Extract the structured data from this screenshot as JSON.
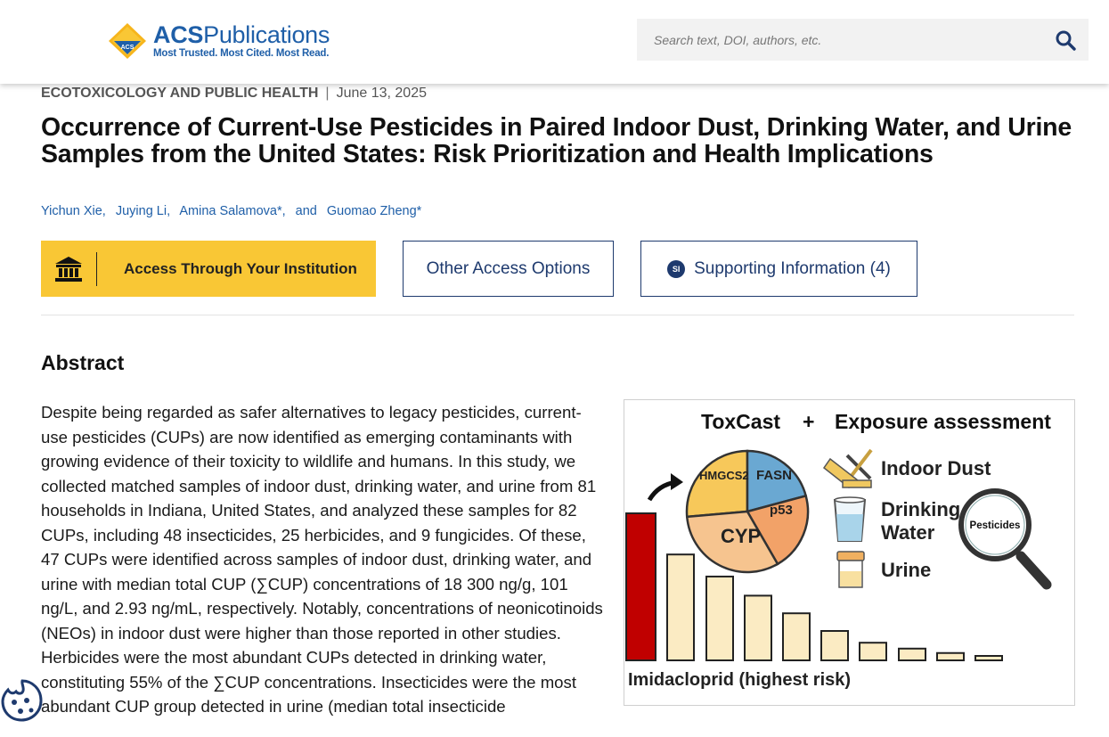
{
  "header": {
    "logo_main": "ACS",
    "logo_sub": "Publications",
    "logo_tagline": "Most Trusted. Most Cited. Most Read.",
    "logo_diamond": "ACS",
    "search_placeholder": "Search text, DOI, authors, etc."
  },
  "article": {
    "category": "ECOTOXICOLOGY AND PUBLIC HEALTH",
    "separator": "|",
    "date": "June 13, 2025",
    "title": "Occurrence of Current-Use Pesticides in Paired Indoor Dust, Drinking Water, and Urine Samples from the United States: Risk Prioritization and Health Implications",
    "authors": [
      "Yichun Xie,",
      "Juying Li,",
      "Amina Salamova*,"
    ],
    "authors_and": "and",
    "last_author": "Guomao Zheng*"
  },
  "access": {
    "institution_label": "Access Through Your Institution",
    "other_label": "Other Access Options",
    "si_badge": "SI",
    "si_label": "Supporting Information (4)"
  },
  "abstract": {
    "heading": "Abstract",
    "text": "Despite being regarded as safer alternatives to legacy pesticides, current-use pesticides (CUPs) are now identified as emerging contaminants with growing evidence of their toxicity to wildlife and humans. In this study, we collected matched samples of indoor dust, drinking water, and urine from 81 households in Indiana, United States, and analyzed these samples for 82 CUPs, including 48 insecticides, 25 herbicides, and 9 fungicides. Of these, 47 CUPs were identified across samples of indoor dust, drinking water, and urine with median total CUP (∑CUP) concentrations of 18 300 ng/g, 101 ng/L, and 2.93 ng/mL, respectively. Notably, concentrations of neonicotinoids (NEOs) in indoor dust were higher than those reported in other studies. Herbicides were the most abundant CUPs detected in drinking water, constituting 55% of the ∑CUP concentrations. Insecticides were the most abundant CUP group detected in urine (median total insecticide"
  },
  "graphic": {
    "toxcast": "ToxCast",
    "plus": "+",
    "exposure": "Exposure assessment",
    "pie_labels": [
      "HMGCS2",
      "FASN",
      "p53",
      "CYP"
    ],
    "pie_colors": [
      "#f7c85a",
      "#6aa8d2",
      "#f2a268",
      "#f6c48f"
    ],
    "items": [
      "Indoor Dust",
      "Drinking",
      "Water",
      "Urine"
    ],
    "magnifier_label": "Pesticides",
    "bar_caption": "Imidacloprid (highest risk)",
    "bar_risk_relative": [
      1.0,
      0.72,
      0.57,
      0.44,
      0.32,
      0.2,
      0.12,
      0.08,
      0.05,
      0.03
    ],
    "highlight_color": "#c00000",
    "bar_color": "#fbebc3"
  },
  "icons": {
    "search": "search-icon",
    "institution": "bank-icon",
    "cookie": "cookie-icon"
  },
  "colors": {
    "brand": "#1f5fa8",
    "institution_button": "#f9c735",
    "outline_button": "#1e3a6e"
  }
}
